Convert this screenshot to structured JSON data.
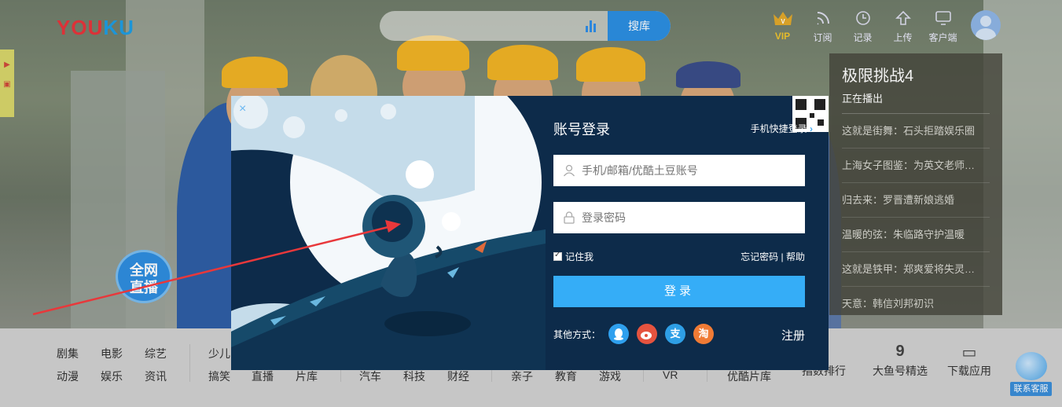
{
  "brand": {
    "logo_main": "YOU",
    "logo_accent": "KU"
  },
  "search": {
    "button_label": "搜库",
    "placeholder": ""
  },
  "top_nav": [
    {
      "label": "VIP",
      "icon": "crown-icon"
    },
    {
      "label": "订阅",
      "icon": "rss-icon"
    },
    {
      "label": "记录",
      "icon": "clock-icon"
    },
    {
      "label": "上传",
      "icon": "upload-icon"
    },
    {
      "label": "客户端",
      "icon": "monitor-icon"
    }
  ],
  "vip_badge": "V",
  "live_badge": {
    "line1": "全网",
    "line2": "直播"
  },
  "playlist": {
    "title": "极限挑战4",
    "subtitle": "正在播出",
    "items": [
      "这就是街舞：石头拒踏娱乐圈",
      "上海女子图鉴：为英文老师…",
      "归去来：罗晋遭新娘逃婚",
      "温暖的弦：朱临路守护温暖",
      "这就是铁甲：郑爽爱将失灵…",
      "天意：韩信刘邦初识"
    ]
  },
  "login_modal": {
    "close": "×",
    "heading": "账号登录",
    "quick_login": "手机快捷登录",
    "quick_arrow": "›",
    "account_placeholder": "手机/邮箱/优酷土豆账号",
    "password_placeholder": "登录密码",
    "remember_me": "记住我",
    "forgot_password": "忘记密码",
    "separator": "|",
    "help": "帮助",
    "login_button": "登录",
    "other_methods": "其他方式：",
    "social": [
      {
        "name": "qq",
        "glyph": "",
        "color": "#2fa0ee"
      },
      {
        "name": "weibo",
        "glyph": "",
        "color": "#e5533f"
      },
      {
        "name": "alipay",
        "glyph": "支",
        "color": "#2e9fe6"
      },
      {
        "name": "taobao",
        "glyph": "淘",
        "color": "#f07b35"
      }
    ],
    "register": "注册"
  },
  "bottom_nav": {
    "col1": [
      [
        "剧集",
        "电影",
        "综艺"
      ],
      [
        "动漫",
        "娱乐",
        "资讯"
      ]
    ],
    "col2_top": [
      "少儿"
    ],
    "col2_bottom": [
      "搞笑",
      "直播",
      "片库"
    ],
    "col3_bottom": [
      "汽车",
      "科技",
      "财经"
    ],
    "col4_bottom": [
      "亲子",
      "教育",
      "游戏"
    ],
    "col5_bottom": [
      "VR"
    ],
    "col6_bottom": [
      "优酷片库"
    ],
    "icon_items": [
      {
        "label": "指数排行",
        "glyph": "▮"
      },
      {
        "label": "大鱼号精选",
        "glyph": "9"
      },
      {
        "label": "下载应用",
        "glyph": "▭"
      }
    ]
  },
  "service": {
    "label": "联系客服"
  },
  "colors": {
    "accent": "#35adf7",
    "modal_bg": "#0d2b4a",
    "logo_red": "#e8343b",
    "logo_blue": "#1e9ee4"
  }
}
